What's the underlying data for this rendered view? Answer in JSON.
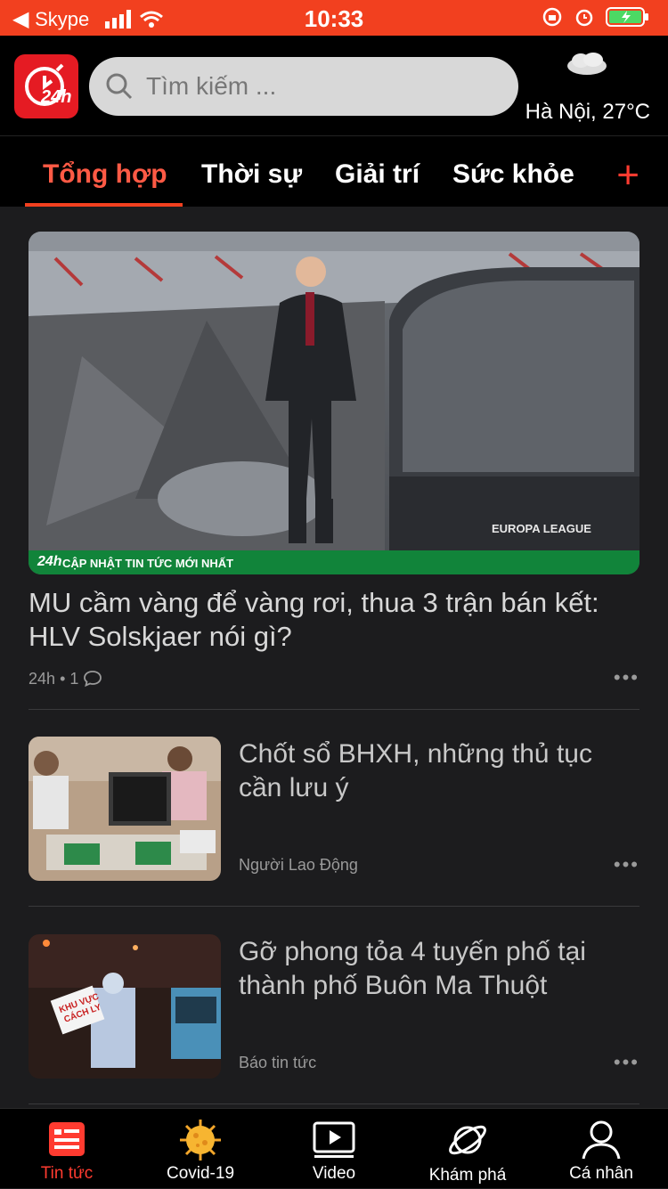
{
  "status_bar": {
    "back_app": "Skype",
    "time": "10:33"
  },
  "header": {
    "search_placeholder": "Tìm kiếm ...",
    "weather_city": "Hà Nội, 27°C",
    "logo_text": "24h"
  },
  "tabs": [
    {
      "label": "Tổng hợp",
      "active": true
    },
    {
      "label": "Thời sự",
      "active": false
    },
    {
      "label": "Giải trí",
      "active": false
    },
    {
      "label": "Sức khỏe",
      "active": false
    }
  ],
  "feed": {
    "hero": {
      "title": "MU cầm vàng để vàng rơi, thua 3 trận bán kết: HLV Solskjaer nói gì?",
      "source": "24h",
      "comments": "1",
      "banner_text": "CẬP NHẬT TIN TỨC MỚI NHẤT",
      "banner_logo": "24h",
      "image_text": "EUROPA LEAGUE"
    },
    "items": [
      {
        "title": "Chốt sổ BHXH, những thủ tục cần lưu ý",
        "source": "Người Lao Động"
      },
      {
        "title": "Gỡ phong tỏa 4 tuyến phố tại thành phố Buôn Ma Thuột",
        "source": "Báo tin tức",
        "image_text": "KHU VỰC CÁCH LY"
      }
    ]
  },
  "tabbar": [
    {
      "label": "Tin tức",
      "icon": "news-icon",
      "active": true
    },
    {
      "label": "Covid-19",
      "icon": "virus-icon",
      "active": false
    },
    {
      "label": "Video",
      "icon": "video-icon",
      "active": false
    },
    {
      "label": "Khám phá",
      "icon": "planet-icon",
      "active": false
    },
    {
      "label": "Cá nhân",
      "icon": "user-icon",
      "active": false
    }
  ],
  "colors": {
    "accent": "#f2401f",
    "active_tab": "#ff5a45",
    "background": "#1c1c1e"
  }
}
